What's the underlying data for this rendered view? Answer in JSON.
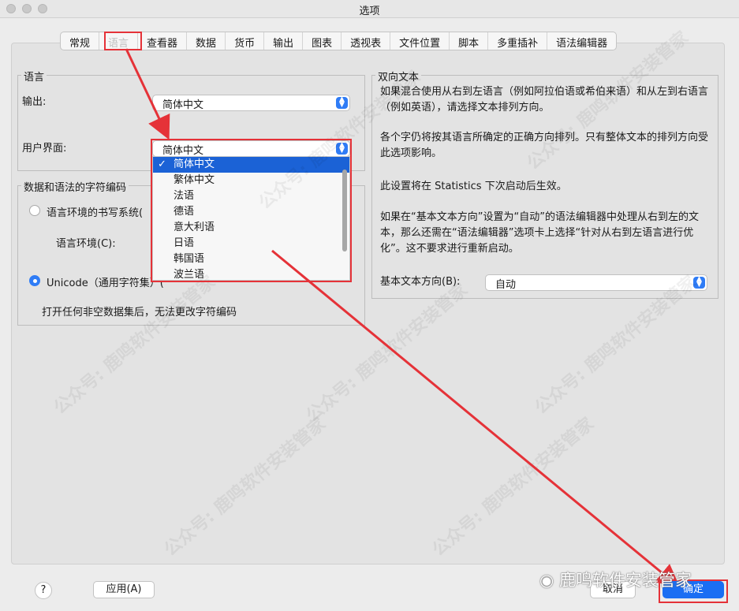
{
  "window": {
    "title": "选项"
  },
  "tabs": [
    "常规",
    "语言",
    "查看器",
    "数据",
    "货币",
    "输出",
    "图表",
    "透视表",
    "文件位置",
    "脚本",
    "多重插补",
    "语法编辑器"
  ],
  "language_group": {
    "legend": "语言",
    "output_label": "输出:",
    "output_value": "简体中文",
    "ui_label": "用户界面:",
    "ui_value": "简体中文",
    "ui_options": [
      "简体中文",
      "繁体中文",
      "法语",
      "德语",
      "意大利语",
      "日语",
      "韩国语",
      "波兰语"
    ],
    "selected_mark": "✓"
  },
  "encoding_group": {
    "legend": "数据和语法的字符编码",
    "locale_radio": "语言环境的书写系统(",
    "locale_label": "语言环境(C):",
    "unicode_radio": "Unicode（通用字符集）(",
    "note": "打开任何非空数据集后，无法更改字符编码"
  },
  "bidi_group": {
    "legend": "双向文本",
    "para1": "如果混合使用从右到左语言（例如阿拉伯语或希伯来语）和从左到右语言（例如英语），请选择文本排列方向。",
    "para2": "各个字仍将按其语言所确定的正确方向排列。只有整体文本的排列方向受此选项影响。",
    "para3": "此设置将在 Statistics 下次启动后生效。",
    "para4": "如果在“基本文本方向”设置为“自动”的语法编辑器中处理从右到左的文本，那么还需在“语法编辑器”选项卡上选择“针对从右到左语言进行优化”。这不要求进行重新启动。",
    "direction_label": "基本文本方向(B):",
    "direction_value": "自动"
  },
  "footer": {
    "help": "?",
    "apply": "应用(A)",
    "cancel": "取消",
    "ok": "确定"
  },
  "watermark": {
    "text": "公众号: 鹿鸣软件安装管家",
    "wechat": "鹿鸣软件安装管家"
  },
  "colors": {
    "accent": "#1b6ef3",
    "highlight": "#e53238"
  }
}
